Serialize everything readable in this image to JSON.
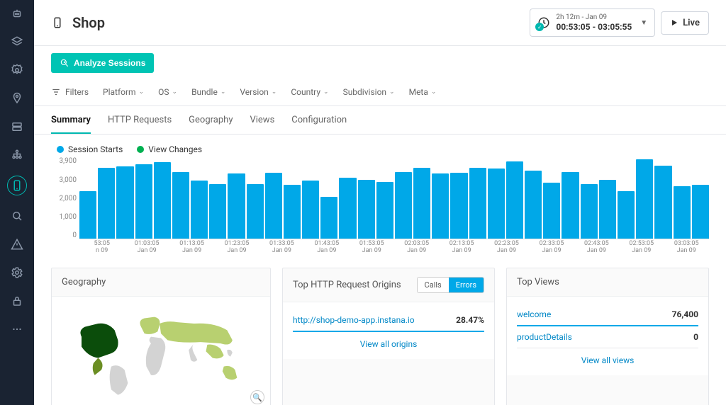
{
  "header": {
    "title": "Shop",
    "time_range_small": "2h 12m - Jan 09",
    "time_range_big": "00:53:05 - 03:05:55",
    "live_label": "Live"
  },
  "actions": {
    "analyze_label": "Analyze Sessions"
  },
  "filters": {
    "label": "Filters",
    "items": [
      "Platform",
      "OS",
      "Bundle",
      "Version",
      "Country",
      "Subdivision",
      "Meta"
    ]
  },
  "tabs": [
    "Summary",
    "HTTP Requests",
    "Geography",
    "Views",
    "Configuration"
  ],
  "active_tab": 0,
  "legend": {
    "series1": "Session Starts",
    "series2": "View Changes",
    "color1": "#00a8e8",
    "color2": "#00b050"
  },
  "chart_data": {
    "type": "bar",
    "ylabel": "",
    "title": "",
    "ylim": [
      0,
      4000
    ],
    "yticks": [
      "3,900",
      "3,000",
      "2,000",
      "1,000",
      "0"
    ],
    "categories": [
      "53:05 n 09",
      "",
      "01:03:05 Jan 09",
      "",
      "01:13:05 Jan 09",
      "",
      "01:23:05 Jan 09",
      "",
      "01:33:05 Jan 09",
      "",
      "01:43:05 Jan 09",
      "",
      "01:53:05 Jan 09",
      "",
      "02:03:05 Jan 09",
      "",
      "02:13:05 Jan 09",
      "",
      "02:23:05 Jan 09",
      "",
      "02:33:05 Jan 09",
      "",
      "02:43:05 Jan 09",
      "",
      "02:53:05 Jan 09",
      "",
      "03:03:05 Jan 09"
    ],
    "values": [
      2350,
      3500,
      3550,
      3650,
      3770,
      3300,
      2850,
      2700,
      3200,
      2700,
      3250,
      2650,
      2850,
      2050,
      3000,
      2900,
      2800,
      3300,
      3500,
      3200,
      3250,
      3500,
      3450,
      3800,
      3350,
      2750,
      3300,
      2700,
      2900,
      2350,
      3900,
      3600,
      2600,
      2650
    ],
    "xlabels": [
      {
        "t1": "53:05",
        "t2": "n 09"
      },
      {
        "t1": "01:03:05",
        "t2": "Jan 09"
      },
      {
        "t1": "01:13:05",
        "t2": "Jan 09"
      },
      {
        "t1": "01:23:05",
        "t2": "Jan 09"
      },
      {
        "t1": "01:33:05",
        "t2": "Jan 09"
      },
      {
        "t1": "01:43:05",
        "t2": "Jan 09"
      },
      {
        "t1": "01:53:05",
        "t2": "Jan 09"
      },
      {
        "t1": "02:03:05",
        "t2": "Jan 09"
      },
      {
        "t1": "02:13:05",
        "t2": "Jan 09"
      },
      {
        "t1": "02:23:05",
        "t2": "Jan 09"
      },
      {
        "t1": "02:33:05",
        "t2": "Jan 09"
      },
      {
        "t1": "02:43:05",
        "t2": "Jan 09"
      },
      {
        "t1": "02:53:05",
        "t2": "Jan 09"
      },
      {
        "t1": "03:03:05",
        "t2": "Jan 09"
      }
    ]
  },
  "geography": {
    "title": "Geography"
  },
  "http_origins": {
    "title": "Top HTTP Request Origins",
    "toggle_calls": "Calls",
    "toggle_errors": "Errors",
    "active_toggle": "errors",
    "rows": [
      {
        "url": "http://shop-demo-app.instana.io",
        "pct": "28.47%"
      }
    ],
    "view_all": "View all origins"
  },
  "top_views": {
    "title": "Top Views",
    "rows": [
      {
        "name": "welcome",
        "count": "76,400"
      },
      {
        "name": "productDetails",
        "count": "0"
      }
    ],
    "view_all": "View all views"
  },
  "sidebar_icons": [
    "robot",
    "stack",
    "gear-hex",
    "pin",
    "server",
    "sitemap",
    "mobile",
    "search",
    "warning",
    "settings",
    "lock",
    "more"
  ],
  "active_sidebar_index": 6
}
